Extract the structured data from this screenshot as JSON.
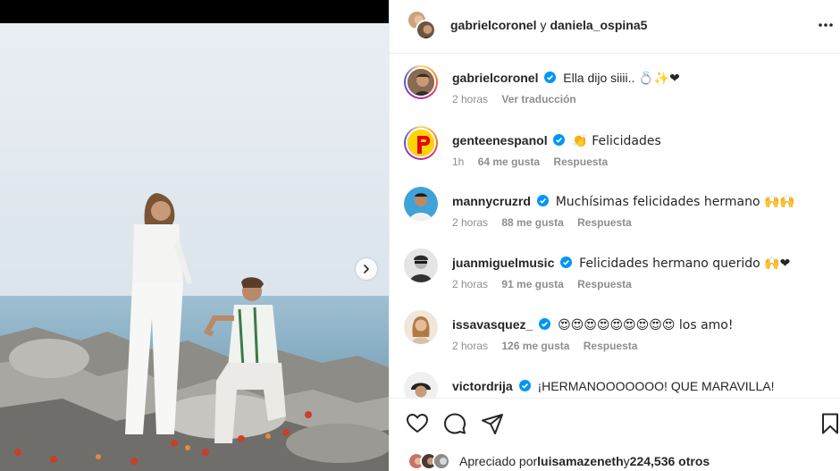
{
  "post": {
    "authors": {
      "user1": "gabrielcoronel",
      "conjunction": "y",
      "user2": "daniela_ospina5"
    },
    "more_icon": "more-horizontal-icon",
    "caption": {
      "username": "gabrielcoronel",
      "text": "Ella dijo siiii..",
      "emojis": "💍✨❤",
      "time": "2 horas",
      "translate": "Ver traducción"
    }
  },
  "comments": [
    {
      "username": "genteenespanol",
      "verified": true,
      "text": "👏 Felicidades",
      "time": "1h",
      "likes": "64 me gusta",
      "reply": "Respuesta"
    },
    {
      "username": "mannycruzrd",
      "verified": true,
      "text": "Muchísimas felicidades hermano 🙌🙌",
      "time": "2 horas",
      "likes": "88 me gusta",
      "reply": "Respuesta"
    },
    {
      "username": "juanmiguelmusic",
      "verified": true,
      "text": "Felicidades hermano querido 🙌❤",
      "time": "2 horas",
      "likes": "91 me gusta",
      "reply": "Respuesta"
    },
    {
      "username": "issavasquez_",
      "verified": true,
      "text": "😍😍😍😍😍😍😍😍😍 los amo!",
      "time": "2 horas",
      "likes": "126 me gusta",
      "reply": "Respuesta"
    },
    {
      "username": "victordrija",
      "verified": true,
      "text": "¡HERMANOOOOOOO! QUE MARAVILLA!",
      "time": "",
      "likes": "",
      "reply": ""
    }
  ],
  "actions": {
    "like_icon": "heart-icon",
    "comment_icon": "comment-icon",
    "share_icon": "share-icon",
    "save_icon": "bookmark-icon"
  },
  "liked_by": {
    "prefix": "Apreciado por",
    "user": "luisamazeneth",
    "conjunction": "y",
    "others": "224,536 otros"
  },
  "colors": {
    "verified": "#0095f6",
    "link": "#00376b",
    "muted": "#8e8e8e",
    "heart_red": "#ed4956"
  }
}
